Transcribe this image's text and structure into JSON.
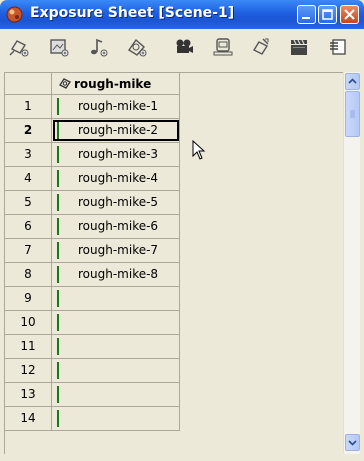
{
  "window": {
    "title": "Exposure Sheet [Scene-1]"
  },
  "toolbar": {
    "tools": [
      {
        "icon": "new-level-icon"
      },
      {
        "icon": "new-raster-level-icon"
      },
      {
        "icon": "new-sound-level-icon"
      },
      {
        "icon": "new-vector-level-icon"
      },
      {
        "icon": "camera-icon"
      },
      {
        "icon": "preview-icon"
      },
      {
        "icon": "stage-schematic-icon"
      },
      {
        "icon": "clapperboard-icon"
      },
      {
        "icon": "menu-icon"
      }
    ]
  },
  "sheet": {
    "column_header": "rough-mike",
    "current_row": 2,
    "selected_row": 2,
    "rows": [
      {
        "frame": "1",
        "cell": "rough-mike-1"
      },
      {
        "frame": "2",
        "cell": "rough-mike-2"
      },
      {
        "frame": "3",
        "cell": "rough-mike-3"
      },
      {
        "frame": "4",
        "cell": "rough-mike-4"
      },
      {
        "frame": "5",
        "cell": "rough-mike-5"
      },
      {
        "frame": "6",
        "cell": "rough-mike-6"
      },
      {
        "frame": "7",
        "cell": "rough-mike-7"
      },
      {
        "frame": "8",
        "cell": "rough-mike-8"
      },
      {
        "frame": "9",
        "cell": ""
      },
      {
        "frame": "10",
        "cell": ""
      },
      {
        "frame": "11",
        "cell": ""
      },
      {
        "frame": "12",
        "cell": ""
      },
      {
        "frame": "13",
        "cell": ""
      },
      {
        "frame": "14",
        "cell": ""
      }
    ]
  },
  "colors": {
    "titlebar": "#1f5fe0",
    "cell_bar": "#1a7a1a",
    "panel": "#ece9d8"
  }
}
